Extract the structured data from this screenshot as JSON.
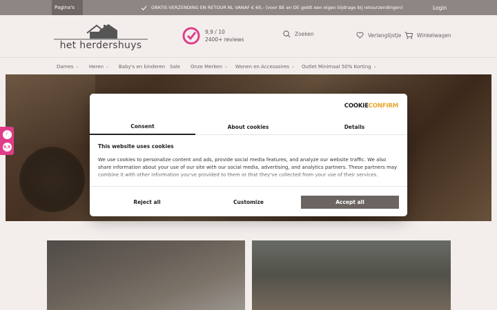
{
  "topbar": {
    "pages_label": "Pagina's",
    "promo": "GRATIS VERZENDING EN RETOUR NL VANAF € 60,- (voor BE en DE geldt een eigen bijdrage bij retourzendingen)",
    "login": "Login"
  },
  "header": {
    "logo_text": "het herdershuys",
    "rating_score": "9,9 / 10",
    "rating_reviews": "2400+ reviews",
    "search_label": "Zoeken",
    "wishlist_label": "Verlanglijstje",
    "cart_label": "Winkelwagen"
  },
  "nav": {
    "items": [
      {
        "label": "Dames"
      },
      {
        "label": "Heren"
      },
      {
        "label": "Baby's en kinderen"
      },
      {
        "label": "Sale"
      },
      {
        "label": "Onze Merken"
      },
      {
        "label": "Wonen en Accessoires"
      },
      {
        "label": "Outlet Minimaal 50% Korting"
      }
    ]
  },
  "side_badge": {
    "top": "✓",
    "bottom": "9,9"
  },
  "cookie": {
    "logo_part1": "COOKIE",
    "logo_part2": "CONFIRM",
    "tabs": [
      "Consent",
      "About cookies",
      "Details"
    ],
    "heading": "This website uses cookies",
    "text": "We use cookies to personalize content and ads, provide social media features, and analyze our website traffic. We also share information about your use of our site with our social media, advertising, and analytics partners. These partners may combine it with other information you've provided to them or that they've collected from your use of their services.",
    "reject": "Reject all",
    "customize": "Customize",
    "accept": "Accept all"
  },
  "colors": {
    "accent_pink": "#e03c8a",
    "topbar": "#8e8682",
    "accept_btn": "#6b6461"
  }
}
